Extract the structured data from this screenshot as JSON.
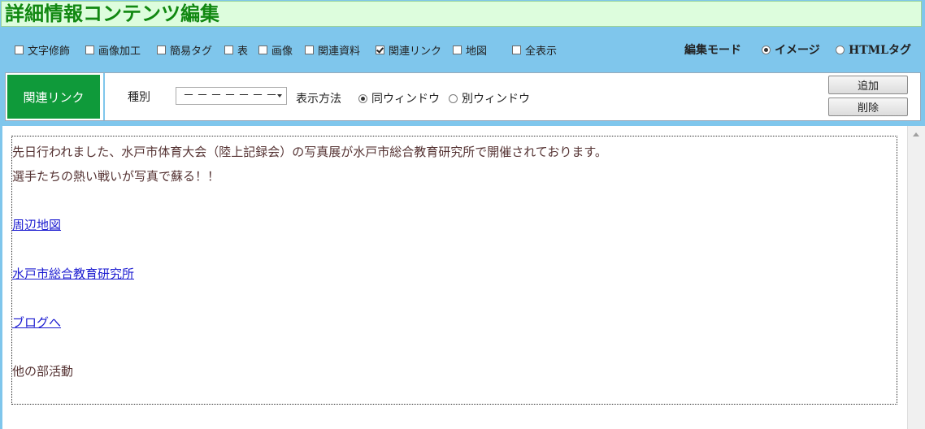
{
  "title": "詳細情報コンテンツ編集",
  "toolbar": {
    "options": [
      {
        "label": "文字修飾",
        "checked": false
      },
      {
        "label": "画像加工",
        "checked": false
      },
      {
        "label": "簡易タグ",
        "checked": false
      },
      {
        "label": "表",
        "checked": false
      },
      {
        "label": "画像",
        "checked": false
      },
      {
        "label": "関連資料",
        "checked": false
      },
      {
        "label": "関連リンク",
        "checked": true
      },
      {
        "label": "地図",
        "checked": false
      }
    ],
    "show_all": {
      "label": "全表示",
      "checked": false
    },
    "edit_mode": {
      "label": "編集モード",
      "options": [
        {
          "label": "イメージ",
          "selected": true
        },
        {
          "label": "HTMLタグ",
          "selected": false
        }
      ]
    }
  },
  "link_panel": {
    "tag": "関連リンク",
    "kind_label": "種別",
    "kind_value": "－－－－－－－",
    "display_label": "表示方法",
    "display_options": [
      {
        "label": "同ウィンドウ",
        "selected": true
      },
      {
        "label": "別ウィンドウ",
        "selected": false
      }
    ],
    "add_button": "追加",
    "delete_button": "削除"
  },
  "content": {
    "lines": [
      "先日行われました、水戸市体育大会（陸上記録会）の写真展が水戸市総合教育研究所で開催されております。",
      "選手たちの熱い戦いが写真で蘇る！！",
      "",
      "周辺地図",
      "",
      "水戸市総合教育研究所",
      "",
      "ブログへ",
      "",
      "他の部活動"
    ]
  },
  "colors": {
    "background": "#7fc6ec",
    "title_text": "#118811",
    "panel_tag": "#0f9a3a",
    "link": "#1a1ad0"
  }
}
